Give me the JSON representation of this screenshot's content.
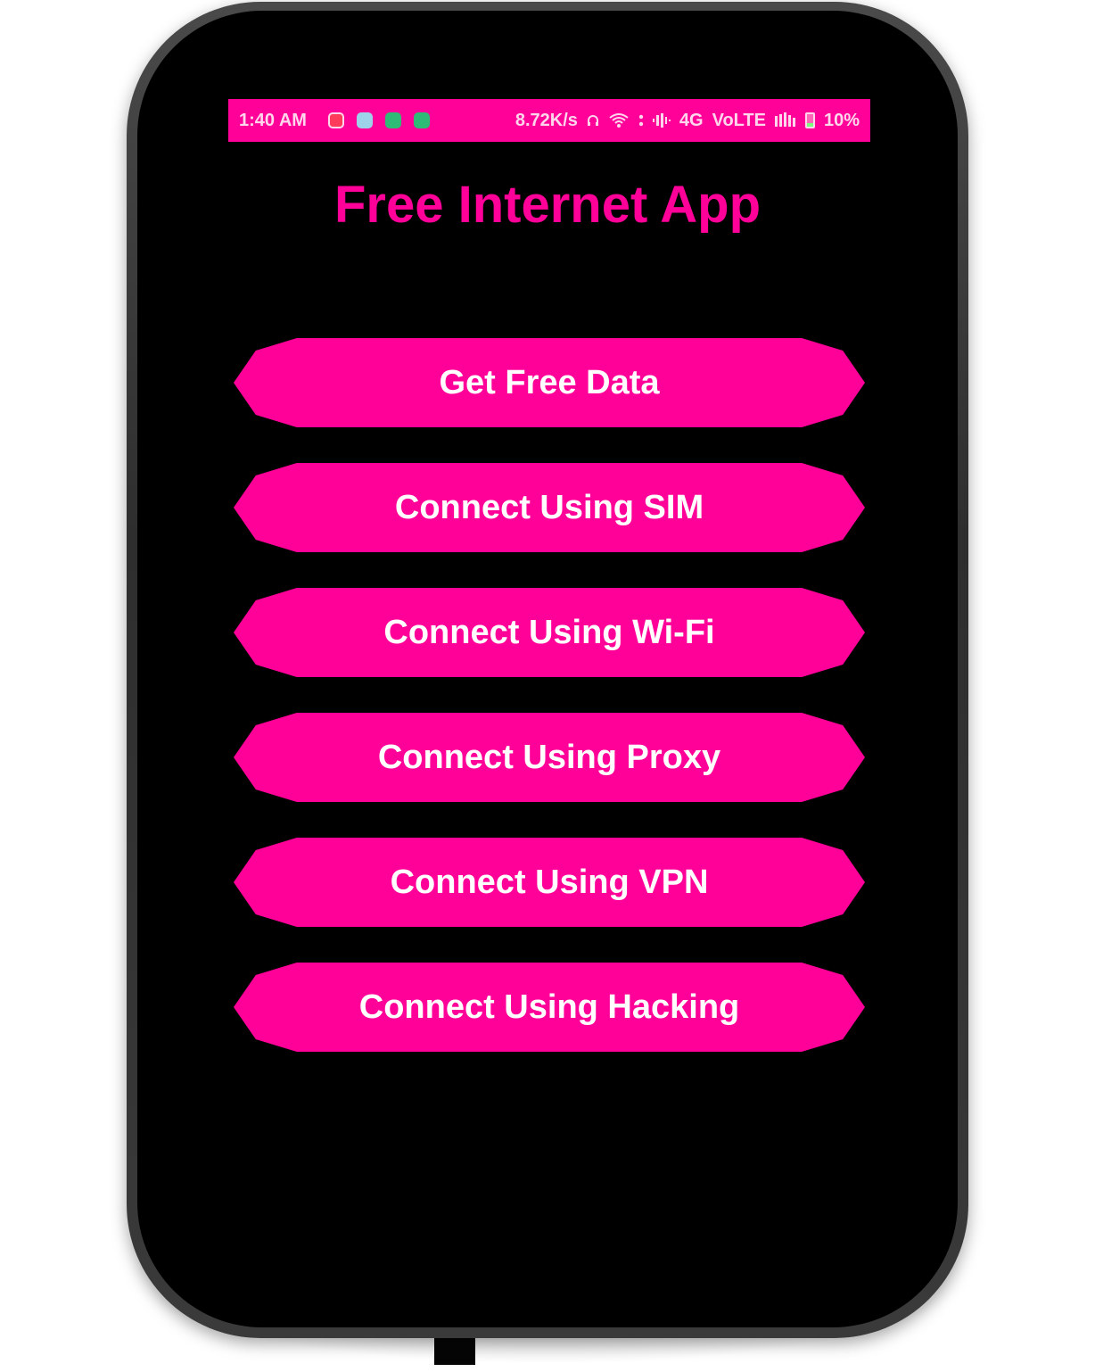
{
  "status_bar": {
    "time": "1:40 AM",
    "app_icons": [
      "music-app-icon",
      "notes-app-icon",
      "game-app-icon",
      "game-app-icon"
    ],
    "net_speed": "8.72K/s",
    "network": "4G",
    "volte": "VoLTE",
    "battery": "10%"
  },
  "app": {
    "title": "Free Internet App"
  },
  "buttons": [
    {
      "label": "Get Free Data"
    },
    {
      "label": "Connect Using SIM"
    },
    {
      "label": "Connect Using Wi-Fi"
    },
    {
      "label": "Connect Using Proxy"
    },
    {
      "label": "Connect Using VPN"
    },
    {
      "label": "Connect Using Hacking"
    }
  ],
  "colors": {
    "accent": "#ff0099",
    "background": "#000000",
    "button_text": "#ffffff"
  }
}
